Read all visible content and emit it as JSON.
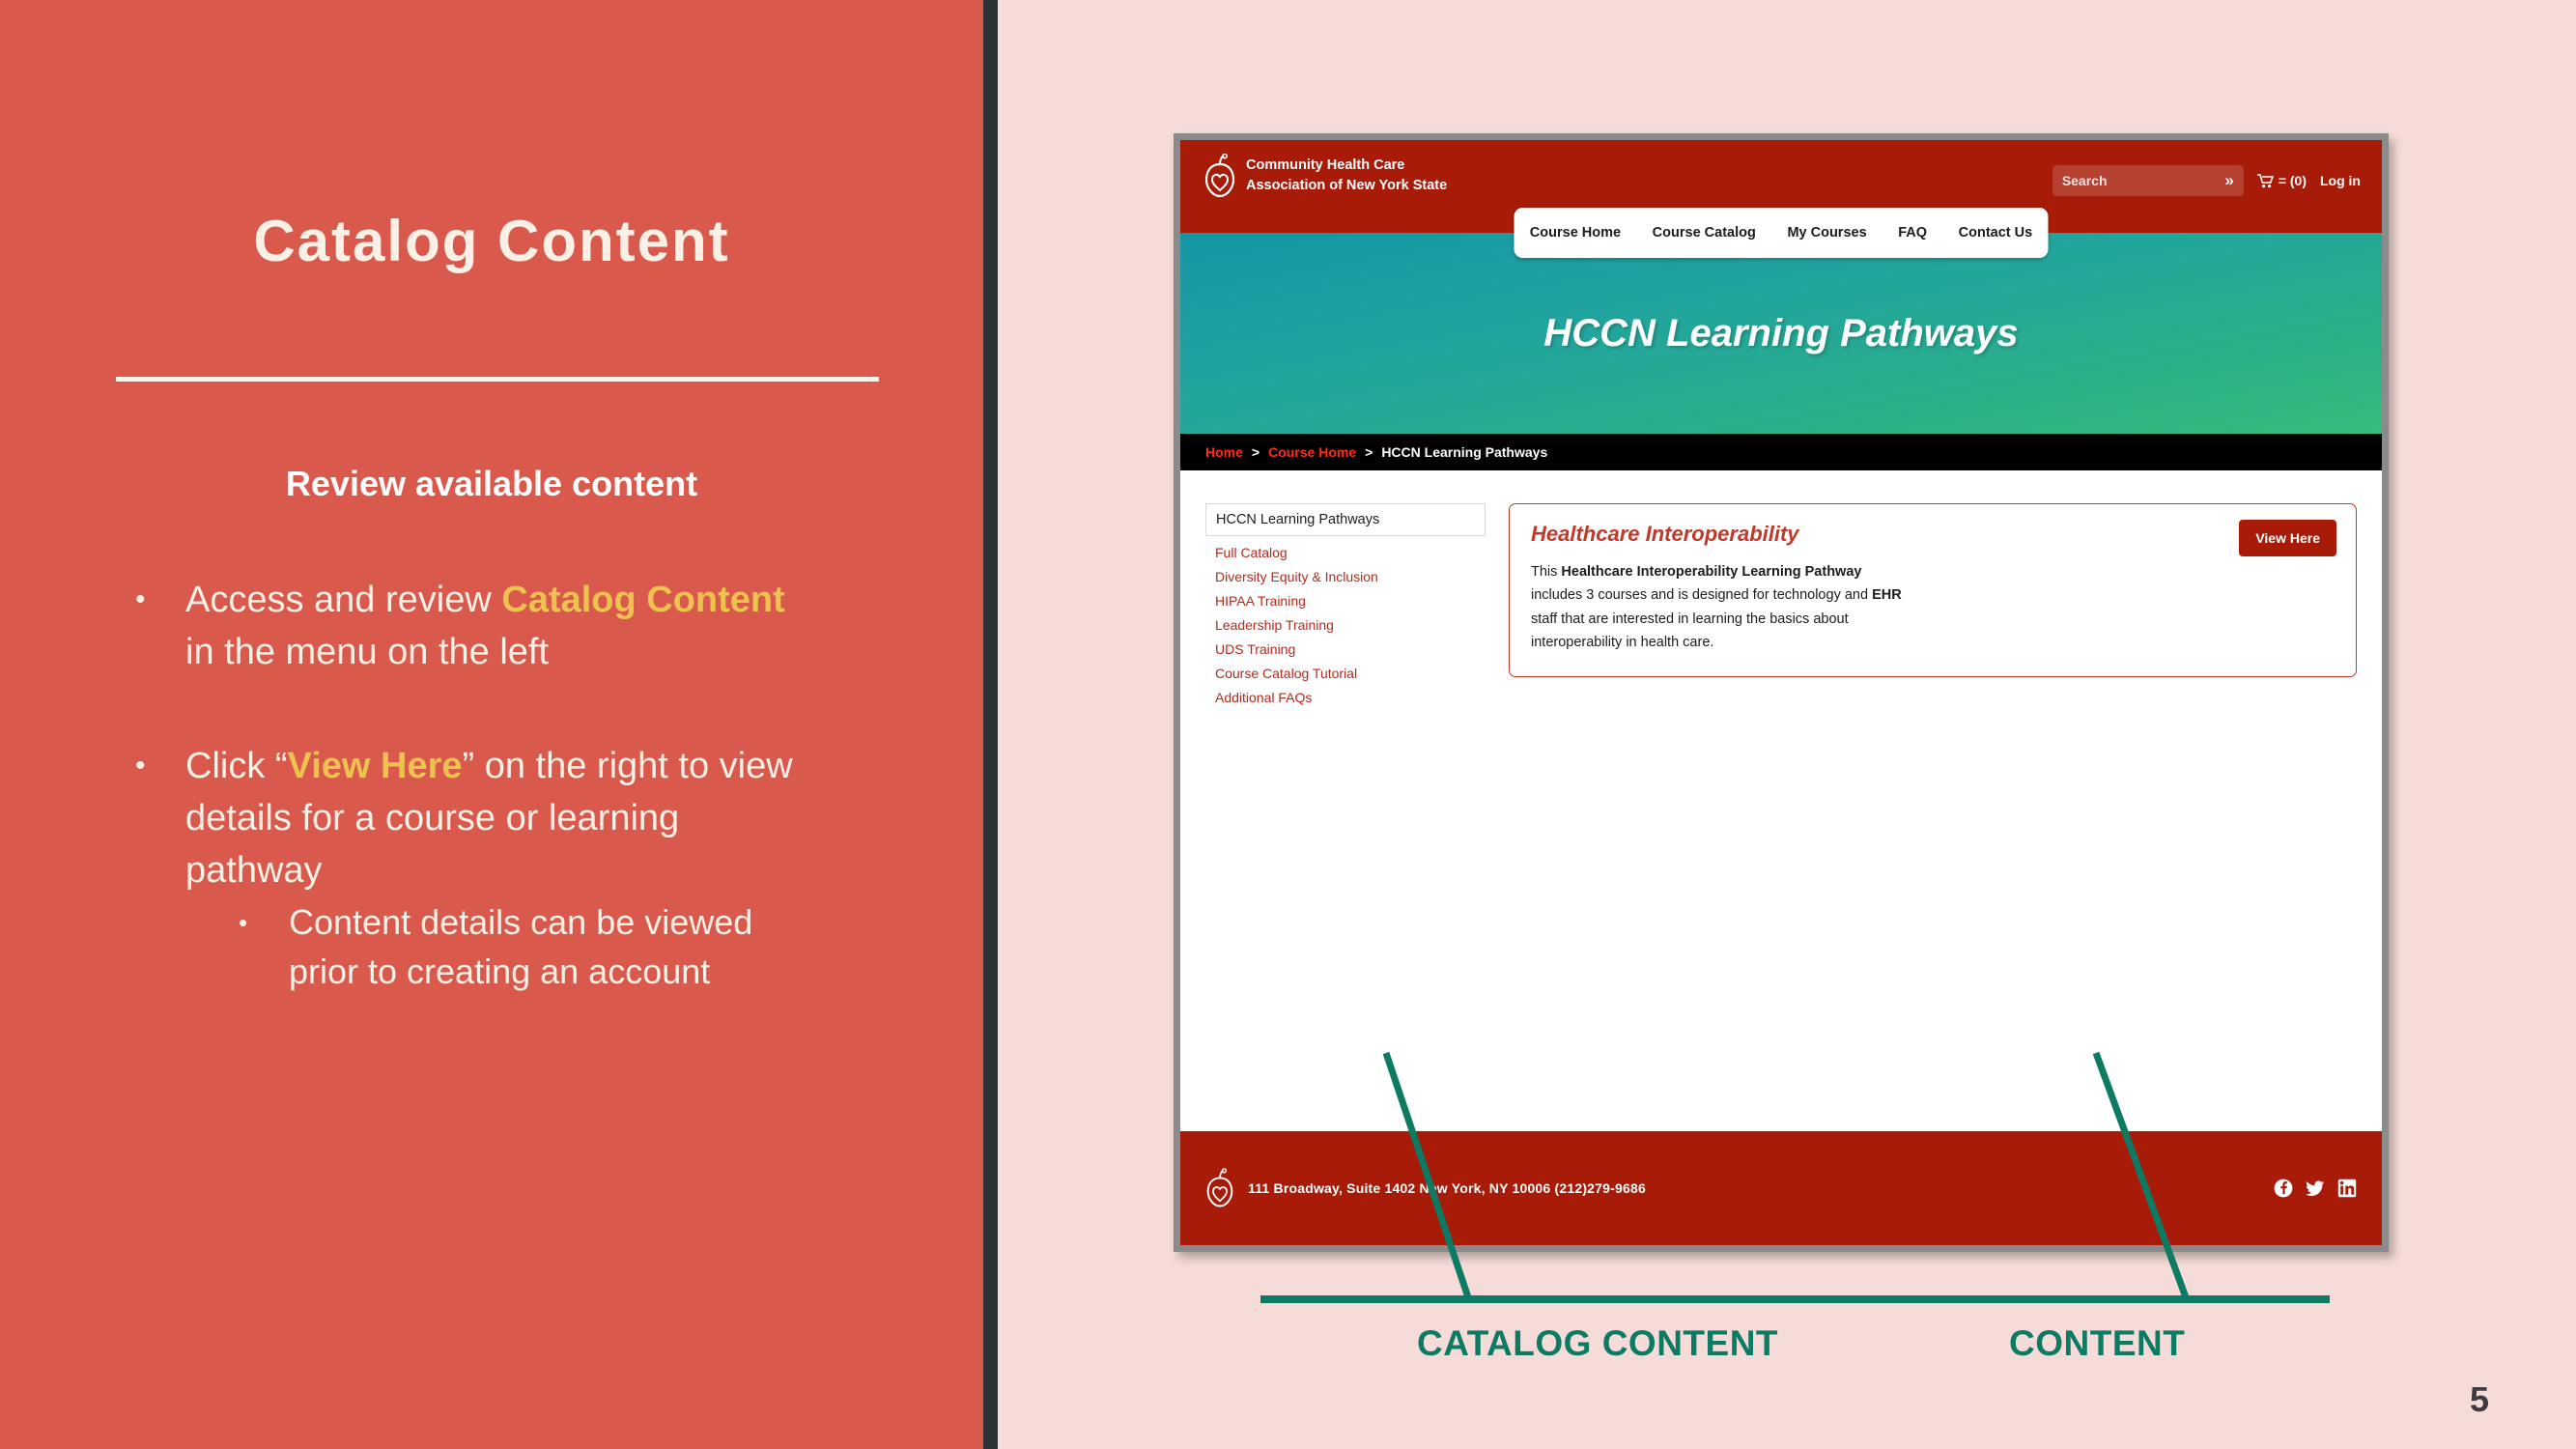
{
  "slide": {
    "title": "Catalog Content",
    "subhead": "Review available content",
    "page_number": "5",
    "bullet_dot": "•",
    "bullets": [
      {
        "pre": "Access and review ",
        "highlight": "Catalog Content",
        "post": " in the menu on the left",
        "sub": []
      },
      {
        "pre": "Click “",
        "highlight": "View Here",
        "post": "” on the right to view details for a course or learning pathway",
        "sub": [
          "Content details can be viewed prior to creating an account"
        ]
      }
    ],
    "colors": {
      "panel_bg": "#d9594c",
      "slide_bg": "#f6dcd8",
      "divider": "#2e3233",
      "highlight": "#edc24f",
      "callout": "#0d7a63"
    }
  },
  "callouts": [
    {
      "label": "CATALOG CONTENT"
    },
    {
      "label": "CONTENT"
    }
  ],
  "screenshot": {
    "header": {
      "logo_line1": "Community Health Care",
      "logo_line2": "Association of New York State",
      "logo_icon": "chcanys-apple-heart-logo",
      "search_placeholder": "Search",
      "search_value": "",
      "search_submit_icon": "double-chevron-right-icon",
      "cart_icon": "shopping-cart-icon",
      "cart_label": "= (0)",
      "login_label": "Log in"
    },
    "nav": {
      "items": [
        "Course Home",
        "Course Catalog",
        "My Courses",
        "FAQ",
        "Contact Us"
      ]
    },
    "hero": {
      "title": "HCCN Learning Pathways"
    },
    "breadcrumb": {
      "items": [
        "Home",
        "Course Home",
        "HCCN Learning Pathways"
      ],
      "separator": ">"
    },
    "side_menu": {
      "header": "HCCN Learning Pathways",
      "links": [
        "Full Catalog",
        "Diversity Equity & Inclusion",
        "HIPAA Training",
        "Leadership Training",
        "UDS Training",
        "Course Catalog Tutorial",
        "Additional FAQs"
      ]
    },
    "card": {
      "title": "Healthcare Interoperability",
      "body_pre": "This ",
      "body_bold1": "Healthcare Interoperability Learning Pathway",
      "body_mid": " includes 3 courses and is designed for technology and ",
      "body_bold2": "EHR",
      "body_post": " staff that are interested in learning the basics about interoperability in health care.",
      "button_label": "View Here"
    },
    "footer": {
      "logo_icon": "chcanys-apple-heart-logo",
      "address": "111 Broadway, Suite 1402   New York, NY 10006   (212)279-9686",
      "social": [
        "facebook-icon",
        "twitter-icon",
        "linkedin-icon"
      ]
    },
    "colors": {
      "brand_red": "#a81b08",
      "link_red": "#b5291d",
      "hero_teal_start": "#1596a4",
      "hero_teal_end": "#36bd7b",
      "breadcrumb_bg": "#000000",
      "crumb_link": "#ff2a1e"
    }
  }
}
